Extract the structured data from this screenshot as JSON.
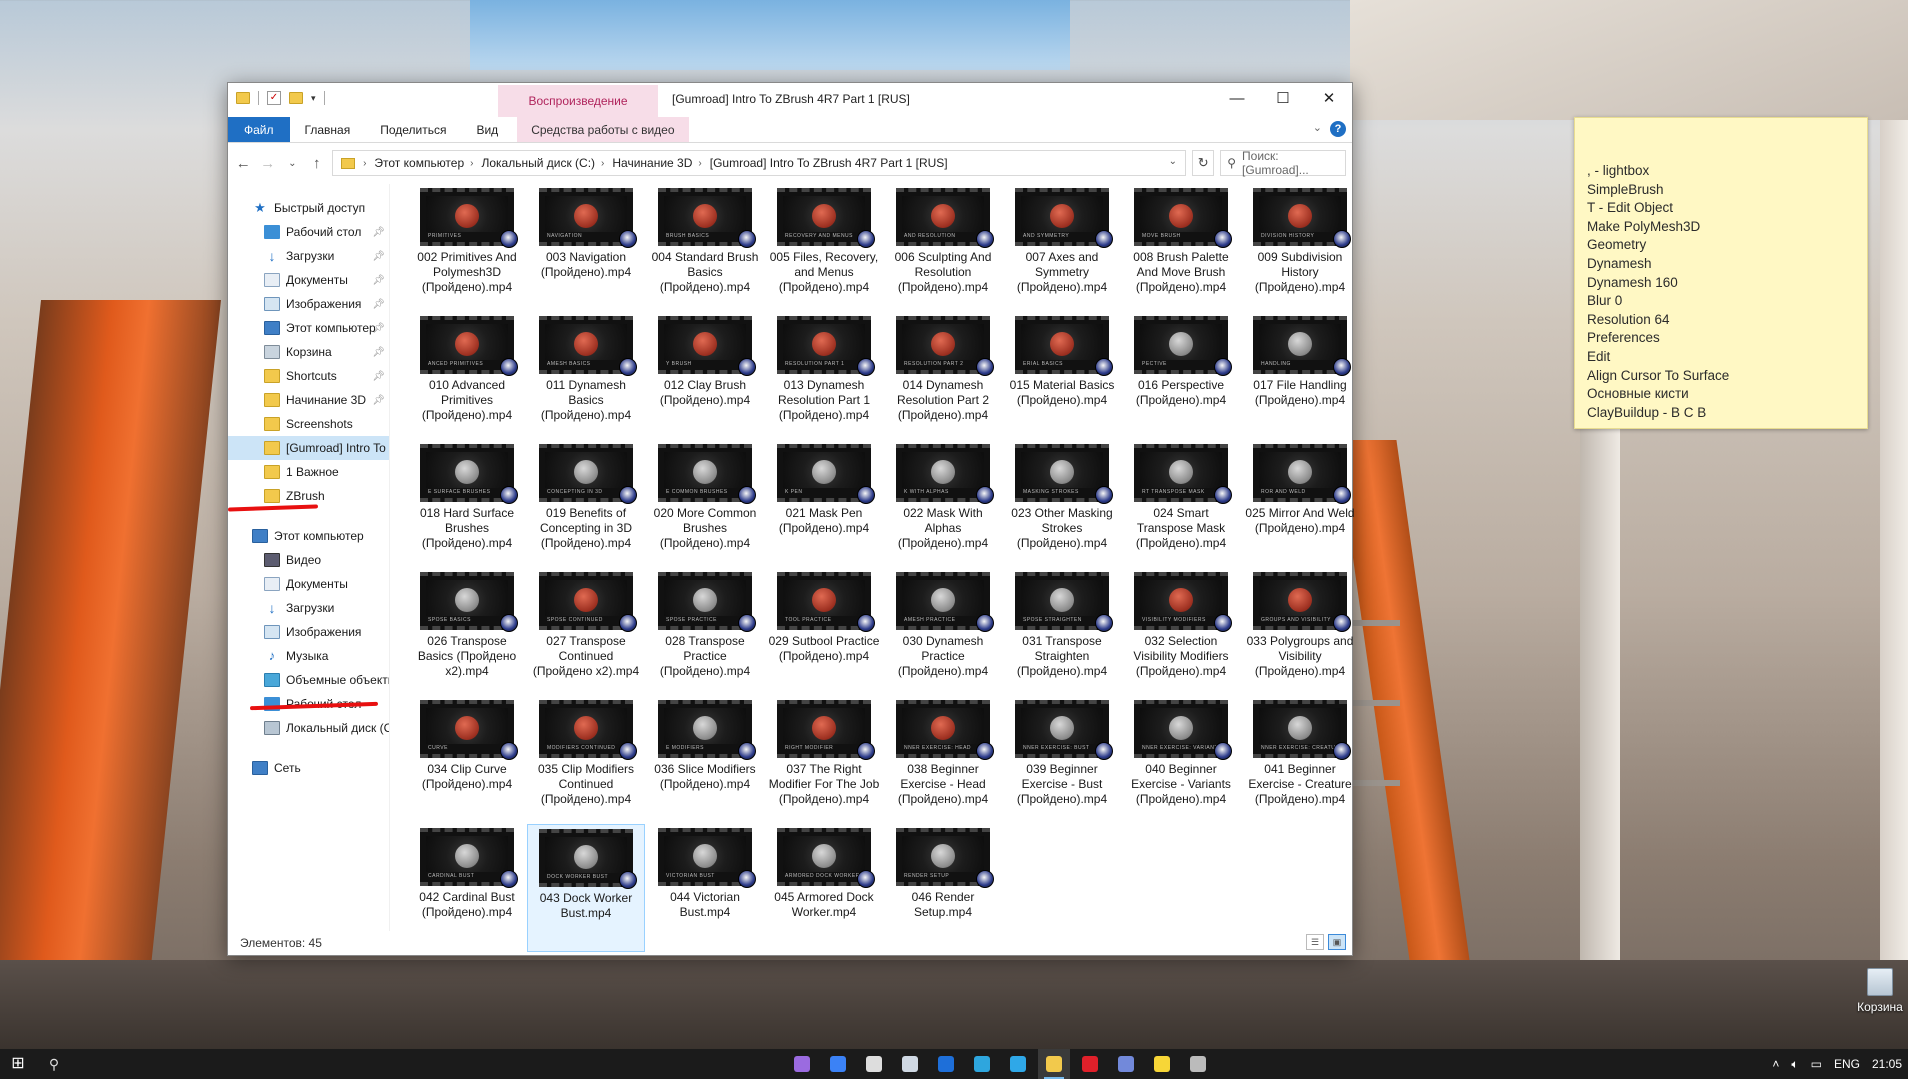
{
  "window": {
    "title": "[Gumroad] Intro To ZBrush 4R7 Part 1 [RUS]",
    "context_tab": "Воспроизведение",
    "controls": {
      "minimize": "—",
      "maximize": "☐",
      "close": "✕"
    }
  },
  "ribbon": {
    "tabs": [
      "Файл",
      "Главная",
      "Поделиться",
      "Вид",
      "Средства работы с видео"
    ],
    "help": "?"
  },
  "address": {
    "crumbs": [
      "Этот компьютер",
      "Локальный диск (C:)",
      "Начинание 3D",
      "[Gumroad] Intro To ZBrush 4R7 Part 1 [RUS]"
    ],
    "search_placeholder": "Поиск: [Gumroad]..."
  },
  "nav": {
    "quick_access": "Быстрый доступ",
    "quick_items": [
      {
        "label": "Рабочий стол",
        "icon": "desktop-icon"
      },
      {
        "label": "Загрузки",
        "icon": "downloads-icon"
      },
      {
        "label": "Документы",
        "icon": "documents-icon"
      },
      {
        "label": "Изображения",
        "icon": "pictures-icon"
      },
      {
        "label": "Этот компьютер",
        "icon": "computer-icon"
      },
      {
        "label": "Корзина",
        "icon": "recycle-bin-icon"
      },
      {
        "label": "Shortcuts",
        "icon": "folder-icon"
      },
      {
        "label": "Начинание 3D",
        "icon": "folder-icon"
      },
      {
        "label": "Screenshots",
        "icon": "folder-icon"
      },
      {
        "label": "[Gumroad] Intro To",
        "icon": "folder-icon"
      },
      {
        "label": "1 Важное",
        "icon": "folder-icon"
      },
      {
        "label": "ZBrush",
        "icon": "folder-icon"
      }
    ],
    "this_pc": "Этот компьютер",
    "pc_items": [
      {
        "label": "Видео",
        "icon": "video-icon"
      },
      {
        "label": "Документы",
        "icon": "documents-icon"
      },
      {
        "label": "Загрузки",
        "icon": "downloads-icon"
      },
      {
        "label": "Изображения",
        "icon": "pictures-icon"
      },
      {
        "label": "Музыка",
        "icon": "music-icon"
      },
      {
        "label": "Объемные объекты",
        "icon": "3d-objects-icon"
      },
      {
        "label": "Рабочий стол",
        "icon": "desktop-icon"
      },
      {
        "label": "Локальный диск (C:)",
        "icon": "drive-icon"
      }
    ],
    "network": "Сеть"
  },
  "files": [
    {
      "name": "002 Primitives And Polymesh3D (Пройдено).mp4",
      "cap": "PRIMITIVES",
      "grey": false
    },
    {
      "name": "003 Navigation (Пройдено).mp4",
      "cap": "NAVIGATION",
      "grey": false
    },
    {
      "name": "004 Standard Brush Basics (Пройдено).mp4",
      "cap": "BRUSH BASICS",
      "grey": false
    },
    {
      "name": "005 Files, Recovery, and Menus (Пройдено).mp4",
      "cap": "RECOVERY AND MENUS",
      "grey": false
    },
    {
      "name": "006 Sculpting And Resolution (Пройдено).mp4",
      "cap": "AND RESOLUTION",
      "grey": false
    },
    {
      "name": "007 Axes and Symmetry (Пройдено).mp4",
      "cap": "AND SYMMETRY",
      "grey": false
    },
    {
      "name": "008 Brush Palette And Move Brush (Пройдено).mp4",
      "cap": "MOVE BRUSH",
      "grey": false
    },
    {
      "name": "009 Subdivision History (Пройдено).mp4",
      "cap": "DIVISION HISTORY",
      "grey": false
    },
    {
      "name": "010 Advanced Primitives (Пройдено).mp4",
      "cap": "ANCED PRIMITIVES",
      "grey": false
    },
    {
      "name": "011 Dynamesh Basics (Пройдено).mp4",
      "cap": "AMESH BASICS",
      "grey": false
    },
    {
      "name": "012 Clay Brush (Пройдено).mp4",
      "cap": "Y BRUSH",
      "grey": false
    },
    {
      "name": "013 Dynamesh Resolution Part 1 (Пройдено).mp4",
      "cap": "RESOLUTION PART 1",
      "grey": false
    },
    {
      "name": "014 Dynamesh Resolution Part 2 (Пройдено).mp4",
      "cap": "RESOLUTION PART 2",
      "grey": false
    },
    {
      "name": "015 Material Basics (Пройдено).mp4",
      "cap": "ERIAL BASICS",
      "grey": false
    },
    {
      "name": "016 Perspective (Пройдено).mp4",
      "cap": "PECTIVE",
      "grey": true
    },
    {
      "name": "017 File Handling (Пройдено).mp4",
      "cap": "HANDLING",
      "grey": true
    },
    {
      "name": "018 Hard Surface Brushes (Пройдено).mp4",
      "cap": "E SURFACE BRUSHES",
      "grey": true
    },
    {
      "name": "019 Benefits of Concepting in 3D (Пройдено).mp4",
      "cap": "CONCEPTING IN 3D",
      "grey": true
    },
    {
      "name": "020 More Common Brushes (Пройдено).mp4",
      "cap": "E COMMON BRUSHES",
      "grey": true
    },
    {
      "name": "021 Mask Pen (Пройдено).mp4",
      "cap": "K PEN",
      "grey": true
    },
    {
      "name": "022 Mask With Alphas (Пройдено).mp4",
      "cap": "K WITH ALPHAS",
      "grey": true
    },
    {
      "name": "023 Other Masking Strokes (Пройдено).mp4",
      "cap": "MASKING STROKES",
      "grey": true
    },
    {
      "name": "024 Smart Transpose Mask (Пройдено).mp4",
      "cap": "RT TRANSPOSE MASK",
      "grey": true
    },
    {
      "name": "025 Mirror And Weld (Пройдено).mp4",
      "cap": "ROR AND WELD",
      "grey": true
    },
    {
      "name": "026 Transpose Basics (Пройдено x2).mp4",
      "cap": "SPOSE BASICS",
      "grey": true
    },
    {
      "name": "027 Transpose Continued (Пройдено x2).mp4",
      "cap": "SPOSE CONTINUED",
      "grey": false
    },
    {
      "name": "028 Transpose Practice (Пройдено).mp4",
      "cap": "SPOSE PRACTICE",
      "grey": true
    },
    {
      "name": "029 Sutbool Practice (Пройдено).mp4",
      "cap": "TOOL PRACTICE",
      "grey": false
    },
    {
      "name": "030 Dynamesh Practice (Пройдено).mp4",
      "cap": "AMESH PRACTICE",
      "grey": true
    },
    {
      "name": "031 Transpose Straighten (Пройдено).mp4",
      "cap": "SPOSE STRAIGHTEN",
      "grey": true
    },
    {
      "name": "032 Selection Visibility Modifiers (Пройдено).mp4",
      "cap": "VISIBILITY MODIFIERS",
      "grey": false
    },
    {
      "name": "033 Polygroups and Visibility (Пройдено).mp4",
      "cap": "GROUPS AND VISIBILITY",
      "grey": false
    },
    {
      "name": "034 Clip Curve (Пройдено).mp4",
      "cap": "CURVE",
      "grey": false
    },
    {
      "name": "035 Clip Modifiers Continued (Пройдено).mp4",
      "cap": "MODIFIERS CONTINUED",
      "grey": false
    },
    {
      "name": "036 Slice Modifiers (Пройдено).mp4",
      "cap": "E MODIFIERS",
      "grey": true
    },
    {
      "name": "037 The Right Modifier For The Job (Пройдено).mp4",
      "cap": "RIGHT MODIFIER",
      "grey": false
    },
    {
      "name": "038 Beginner Exercise - Head (Пройдено).mp4",
      "cap": "NNER EXERCISE: HEAD",
      "grey": false
    },
    {
      "name": "039 Beginner Exercise - Bust (Пройдено).mp4",
      "cap": "NNER EXERCISE: BUST",
      "grey": true
    },
    {
      "name": "040 Beginner Exercise - Variants (Пройдено).mp4",
      "cap": "NNER EXERCISE: VARIANTS",
      "grey": true
    },
    {
      "name": "041 Beginner Exercise - Creature (Пройдено).mp4",
      "cap": "NNER EXERCISE: CREATURE",
      "grey": true
    },
    {
      "name": "042 Cardinal Bust (Пройдено).mp4",
      "cap": "CARDINAL BUST",
      "grey": true
    },
    {
      "name": "043 Dock Worker Bust.mp4",
      "cap": "DOCK WORKER BUST",
      "grey": true,
      "selected": true
    },
    {
      "name": "044 Victorian Bust.mp4",
      "cap": "VICTORIAN BUST",
      "grey": true
    },
    {
      "name": "045 Armored Dock Worker.mp4",
      "cap": "ARMORED DOCK WORKER",
      "grey": true
    },
    {
      "name": "046 Render Setup.mp4",
      "cap": "RENDER SETUP",
      "grey": true
    }
  ],
  "status": {
    "count": "Элементов: 45"
  },
  "sticky_note": [
    ", - lightbox",
    "SimpleBrush",
    "T - Edit Object",
    "Make PolyMesh3D",
    "Geometry",
    "Dynamesh",
    "Dynamesh 160",
    "Blur 0",
    "Resolution 64",
    "Preferences",
    "Edit",
    "Align Cursor To Surface",
    "Основные кисти",
    "ClayBuildup - B C B"
  ],
  "desktop": {
    "recycle_bin": "Корзина"
  },
  "taskbar": {
    "apps": [
      {
        "name": "feather-app-icon",
        "color": "#9b6be0"
      },
      {
        "name": "todo-app-icon",
        "color": "#3b82f6"
      },
      {
        "name": "shield-app-icon",
        "color": "#dddddd"
      },
      {
        "name": "steam-app-icon",
        "color": "#cfd8e3"
      },
      {
        "name": "teamviewer-app-icon",
        "color": "#1e6fd9"
      },
      {
        "name": "telegram-app-icon",
        "color": "#2ea6de"
      },
      {
        "name": "paint-app-icon",
        "color": "#2fa8e8"
      },
      {
        "name": "explorer-app-icon",
        "color": "#f2c94c",
        "active": true
      },
      {
        "name": "opera-app-icon",
        "color": "#e0202a"
      },
      {
        "name": "discord-app-icon",
        "color": "#7289da"
      },
      {
        "name": "sticky-notes-app-icon",
        "color": "#f7d637"
      },
      {
        "name": "zbrush-app-icon",
        "color": "#bbbbbb"
      }
    ],
    "lang": "ENG",
    "time": "21:05"
  }
}
